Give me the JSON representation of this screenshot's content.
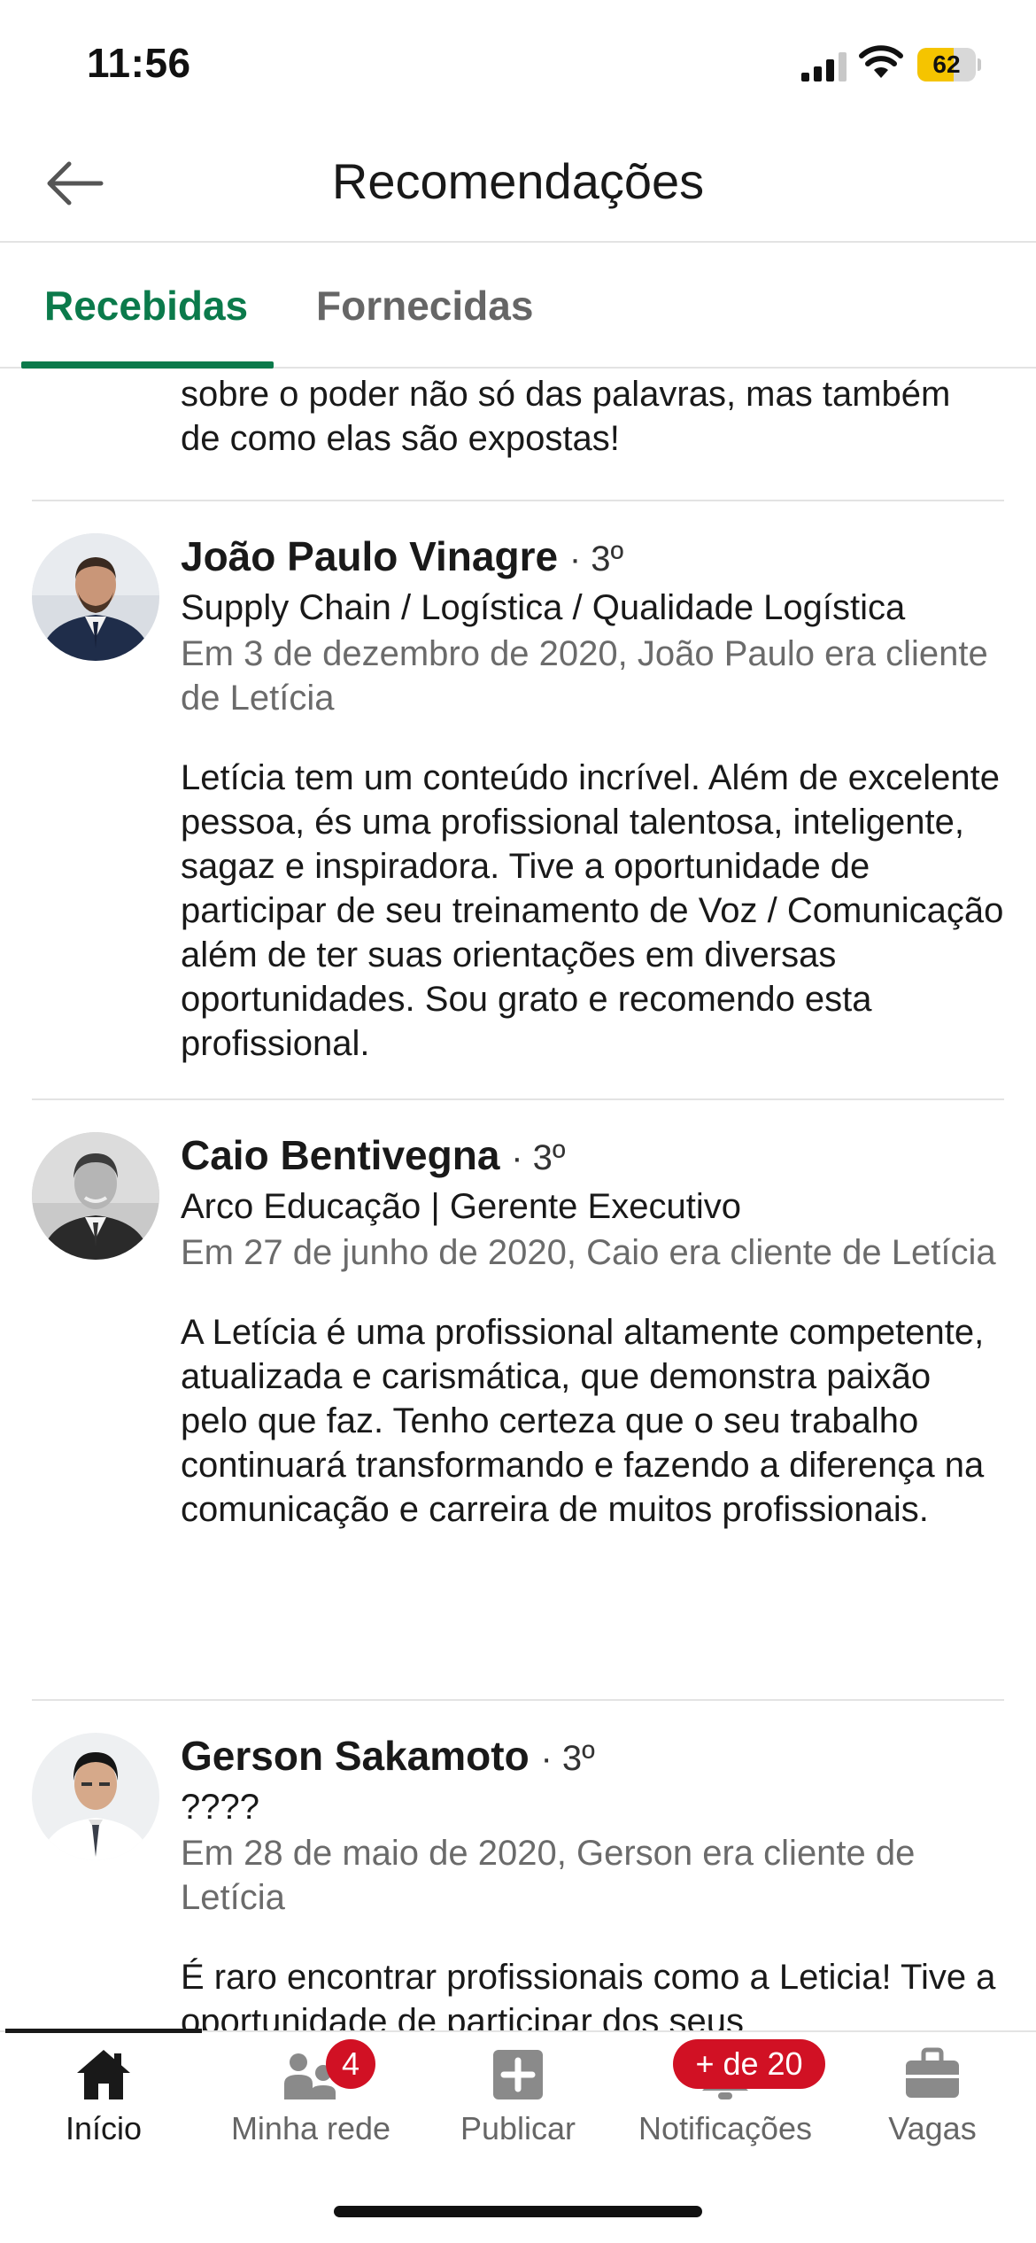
{
  "status": {
    "time": "11:56",
    "battery": "62",
    "battery_level": 0.62,
    "battery_color": "#f5c400"
  },
  "header": {
    "title": "Recomendações",
    "back_icon": "arrow-left-icon"
  },
  "tabs": [
    {
      "label": "Recebidas",
      "active": true
    },
    {
      "label": "Fornecidas",
      "active": false
    }
  ],
  "partial": {
    "edge": "o",
    "text": "sobre o poder não só das palavras, mas também de como elas são expostas!"
  },
  "recommendations": [
    {
      "name": "João Paulo Vinagre",
      "degree": "· 3º",
      "headline": "Supply Chain / Logística / Qualidade Logística",
      "meta": "Em 3 de dezembro de 2020, João Paulo era cliente de Letícia",
      "text": "Letícia tem um conteúdo incrível. Além de excelente pessoa, és uma profissional talentosa, inteligente, sagaz e inspiradora. Tive a oportunidade de participar de seu treinamento de Voz / Comunicação além de ter suas orientações em diversas oportunidades. Sou grato e recomendo esta profissional."
    },
    {
      "name": "Caio Bentivegna",
      "degree": "· 3º",
      "headline": "Arco Educação | Gerente Executivo",
      "meta": "Em 27 de junho de 2020, Caio era cliente de Letícia",
      "text": "A Letícia é uma profissional altamente competente, atualizada e carismática, que demonstra paixão pelo que faz. Tenho certeza que o seu trabalho continuará transformando e fazendo a diferença na comunicação e carreira de muitos profissionais."
    },
    {
      "name": "Gerson Sakamoto",
      "degree": "· 3º",
      "headline": "????",
      "meta": "Em 28 de maio de 2020, Gerson era cliente de Letícia",
      "text": "É raro encontrar profissionais como a Leticia! Tive a oportunidade de participar dos seus"
    }
  ],
  "nav": [
    {
      "label": "Início",
      "icon": "home-icon",
      "active": true
    },
    {
      "label": "Minha rede",
      "icon": "network-icon",
      "badge": "4"
    },
    {
      "label": "Publicar",
      "icon": "plus-square-icon"
    },
    {
      "label": "Notificações",
      "icon": "bell-icon",
      "badge": "+ de 20"
    },
    {
      "label": "Vagas",
      "icon": "briefcase-icon"
    }
  ],
  "colors": {
    "accent": "#0b7a4b",
    "badge": "#d11124",
    "muted": "#6b6b6b"
  }
}
